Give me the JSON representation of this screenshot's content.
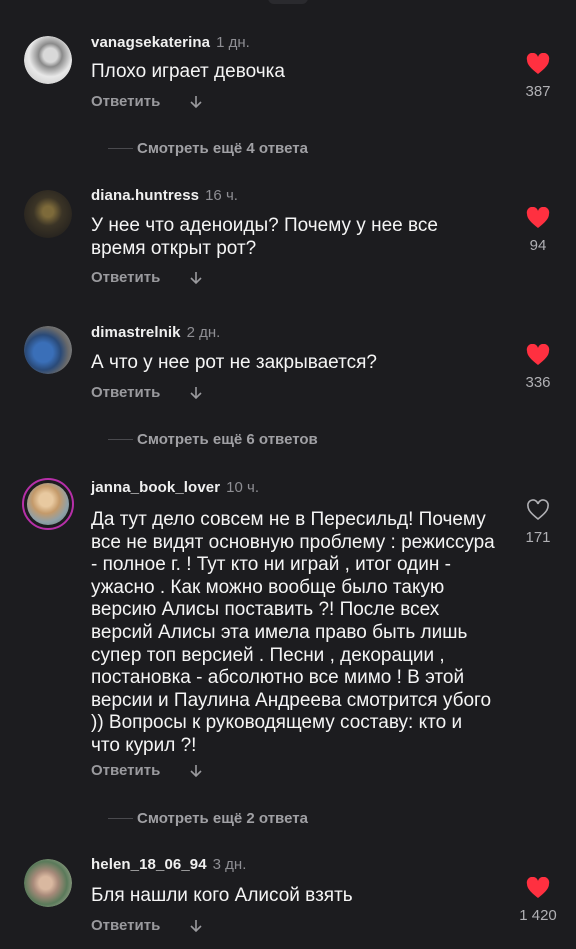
{
  "comments": [
    {
      "username": "vanagsekaterina",
      "time": "1 дн.",
      "text": "Плохо играет девочка",
      "reply_label": "Ответить",
      "likes": "387",
      "liked": true,
      "more_replies": "Смотреть ещё 4 ответа"
    },
    {
      "username": "diana.huntress",
      "time": "16 ч.",
      "text": "У нее что аденоиды? Почему у нее все время открыт рот?",
      "reply_label": "Ответить",
      "likes": "94",
      "liked": true,
      "more_replies": ""
    },
    {
      "username": "dimastrelnik",
      "time": "2 дн.",
      "text": "А что у нее рот не закрывается?",
      "reply_label": "Ответить",
      "likes": "336",
      "liked": true,
      "more_replies": "Смотреть ещё 6 ответов"
    },
    {
      "username": "janna_book_lover",
      "time": "10 ч.",
      "text": "Да тут дело совсем не в Пересильд! Почему все не видят основную проблему : режиссура - полное г. ! Тут кто ни играй , итог один - ужасно . Как можно вообще было такую версию Алисы поставить ?! После всех версий Алисы эта имела право быть лишь супер топ версией . Песни , декорации , постановка - абсолютно все мимо ! В этой версии и Паулина Андреева смотрится убого )) Вопросы к руководящему составу: кто и что курил ?!",
      "reply_label": "Ответить",
      "likes": "171",
      "liked": false,
      "more_replies": "Смотреть ещё 2 ответа"
    },
    {
      "username": "helen_18_06_94",
      "time": "3 дн.",
      "text": "Бля нашли кого Алисой взять",
      "reply_label": "Ответить",
      "likes": "1 420",
      "liked": true,
      "more_replies": ""
    }
  ],
  "colors": {
    "background": "#1c1c1f",
    "like_red": "#ff3040",
    "muted": "#9a9a9e",
    "story_ring": "#b62fa8"
  }
}
